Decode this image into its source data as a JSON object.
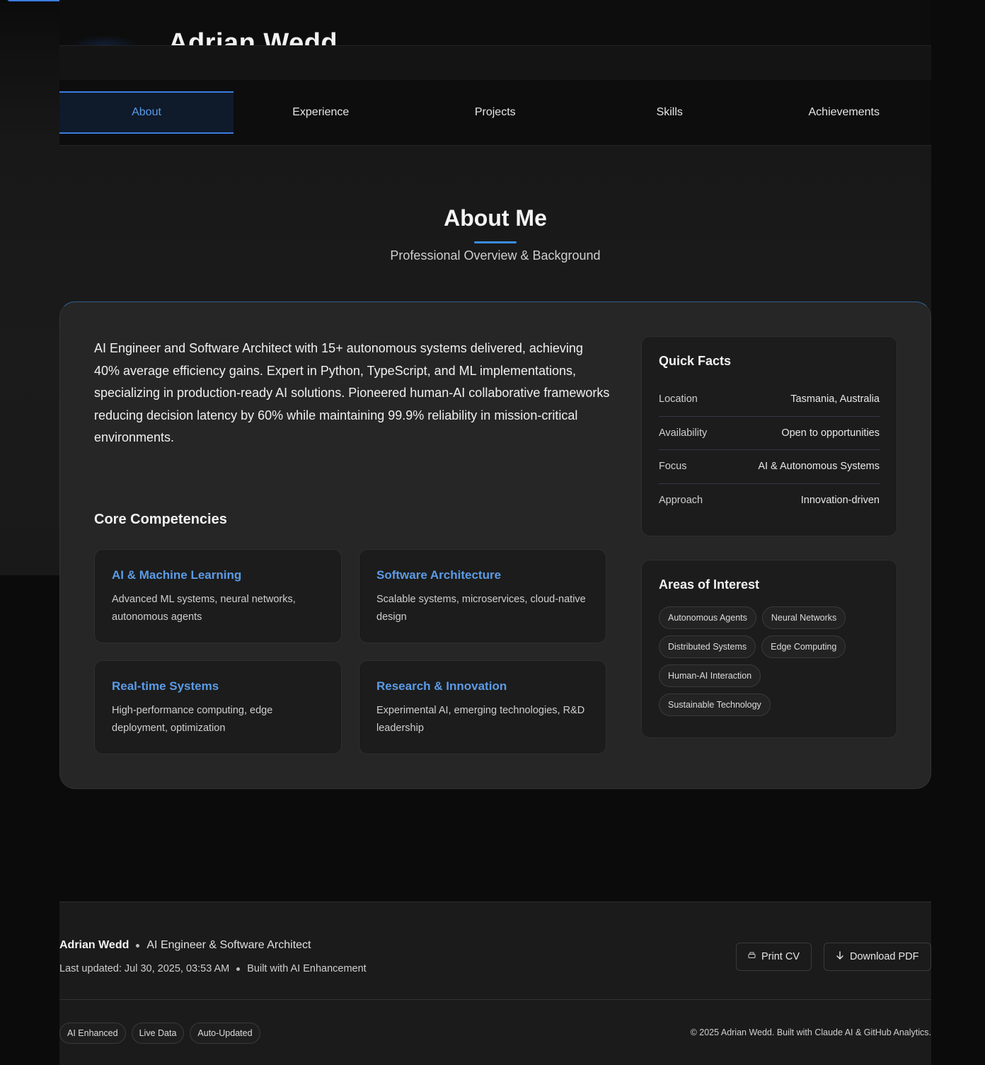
{
  "header": {
    "name": "Adrian Wedd"
  },
  "tabs": [
    {
      "label": "About",
      "active": true
    },
    {
      "label": "Experience",
      "active": false
    },
    {
      "label": "Projects",
      "active": false
    },
    {
      "label": "Skills",
      "active": false
    },
    {
      "label": "Achievements",
      "active": false
    }
  ],
  "section": {
    "title": "About Me",
    "subtitle": "Professional Overview & Background"
  },
  "about": {
    "bio": "AI Engineer and Software Architect with 15+ autonomous systems delivered, achieving 40% average efficiency gains. Expert in Python, TypeScript, and ML implementations, specializing in production-ready AI solutions. Pioneered human-AI collaborative frameworks reducing decision latency by 60% while maintaining 99.9% reliability in mission-critical environments.",
    "competencies_title": "Core Competencies",
    "competencies": [
      {
        "title": "AI & Machine Learning",
        "desc": "Advanced ML systems, neural networks, autonomous agents"
      },
      {
        "title": "Software Architecture",
        "desc": "Scalable systems, microservices, cloud-native design"
      },
      {
        "title": "Real-time Systems",
        "desc": "High-performance computing, edge deployment, optimization"
      },
      {
        "title": "Research & Innovation",
        "desc": "Experimental AI, emerging technologies, R&D leadership"
      }
    ]
  },
  "quick_facts": {
    "title": "Quick Facts",
    "rows": [
      {
        "key": "Location",
        "value": "Tasmania, Australia"
      },
      {
        "key": "Availability",
        "value": "Open to opportunities"
      },
      {
        "key": "Focus",
        "value": "AI & Autonomous Systems"
      },
      {
        "key": "Approach",
        "value": "Innovation-driven"
      }
    ]
  },
  "interests": {
    "title": "Areas of Interest",
    "tags": [
      "Autonomous Agents",
      "Neural Networks",
      "Distributed Systems",
      "Edge Computing",
      "Human-AI Interaction",
      "Sustainable Technology"
    ]
  },
  "footer": {
    "name": "Adrian Wedd",
    "role": "AI Engineer & Software Architect",
    "last_updated": "Last updated: Jul 30, 2025, 03:53 AM",
    "built_with": "Built with AI Enhancement",
    "print_label": "Print CV",
    "download_label": "Download PDF",
    "badges": [
      "AI Enhanced",
      "Live Data",
      "Auto-Updated"
    ],
    "copyright": "© 2025 Adrian Wedd. Built with Claude AI & GitHub Analytics."
  },
  "colors": {
    "accent": "#3b7ddd",
    "accent_text": "#5b9be6",
    "background": "#0b0b0b",
    "card": "#262626"
  }
}
